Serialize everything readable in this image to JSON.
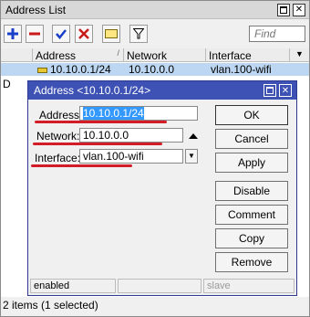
{
  "window": {
    "title": "Address List"
  },
  "toolbar": {
    "find_placeholder": "Find"
  },
  "table": {
    "columns": [
      "Address",
      "Network",
      "Interface"
    ],
    "selected_row": {
      "address": "10.10.0.1/24",
      "network": "10.10.0.0",
      "interface": "vlan.100-wifi"
    },
    "second_row_flag": "D"
  },
  "status_bar": {
    "text": "2 items (1 selected)"
  },
  "dialog": {
    "title": "Address <10.10.0.1/24>",
    "address_label": "Address:",
    "address_value": "10.10.0.1/24",
    "network_label": "Network:",
    "network_value": "10.10.0.0",
    "interface_label": "Interface:",
    "interface_value": "vlan.100-wifi",
    "buttons": {
      "ok": "OK",
      "cancel": "Cancel",
      "apply": "Apply",
      "disable": "Disable",
      "comment": "Comment",
      "copy": "Copy",
      "remove": "Remove"
    },
    "status": {
      "state": "enabled",
      "middle": "",
      "right": "slave"
    }
  },
  "colors": {
    "dialog_title_bar": "#3e52b5",
    "selection": "#bdd7f2",
    "annotation_red": "#d41c28",
    "add_icon": "#1a3fc8",
    "remove_icon": "#c81a1a"
  }
}
